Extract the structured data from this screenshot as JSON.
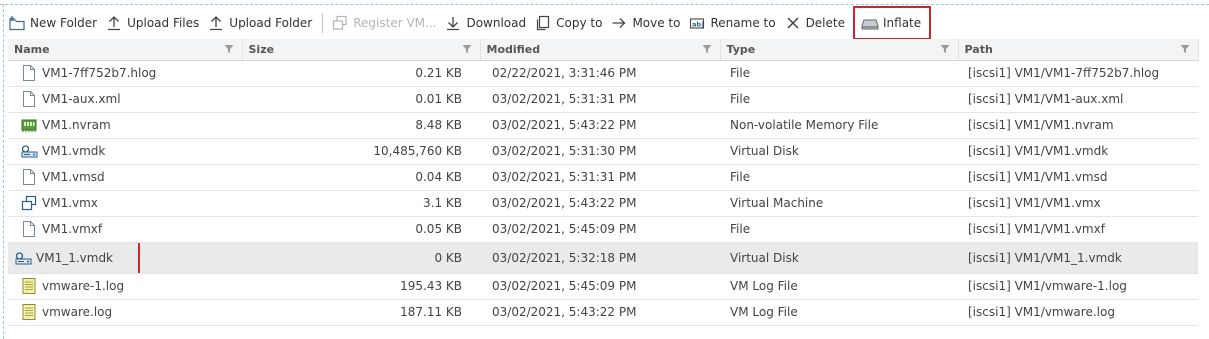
{
  "toolbar": {
    "new_folder": "New Folder",
    "upload_files": "Upload Files",
    "upload_folder": "Upload Folder",
    "register_vm": "Register VM...",
    "download": "Download",
    "copy_to": "Copy to",
    "move_to": "Move to",
    "rename_to": "Rename to",
    "delete": "Delete",
    "inflate": "Inflate"
  },
  "table": {
    "columns": [
      "Name",
      "Size",
      "Modified",
      "Type",
      "Path"
    ],
    "rows": [
      {
        "name": "VM1-7ff752b7.hlog",
        "size": "0.21 KB",
        "modified": "02/22/2021, 3:31:46 PM",
        "type": "File",
        "path": "[iscsi1] VM1/VM1-7ff752b7.hlog",
        "icon": "file-icon"
      },
      {
        "name": "VM1-aux.xml",
        "size": "0.01 KB",
        "modified": "03/02/2021, 5:31:31 PM",
        "type": "File",
        "path": "[iscsi1] VM1/VM1-aux.xml",
        "icon": "file-icon"
      },
      {
        "name": "VM1.nvram",
        "size": "8.48 KB",
        "modified": "03/02/2021, 5:43:22 PM",
        "type": "Non-volatile Memory File",
        "path": "[iscsi1] VM1/VM1.nvram",
        "icon": "nvram-icon"
      },
      {
        "name": "VM1.vmdk",
        "size": "10,485,760 KB",
        "modified": "03/02/2021, 5:31:30 PM",
        "type": "Virtual Disk",
        "path": "[iscsi1] VM1/VM1.vmdk",
        "icon": "virtual-disk-icon"
      },
      {
        "name": "VM1.vmsd",
        "size": "0.04 KB",
        "modified": "03/02/2021, 5:31:31 PM",
        "type": "File",
        "path": "[iscsi1] VM1/VM1.vmsd",
        "icon": "file-icon"
      },
      {
        "name": "VM1.vmx",
        "size": "3.1 KB",
        "modified": "03/02/2021, 5:43:22 PM",
        "type": "Virtual Machine",
        "path": "[iscsi1] VM1/VM1.vmx",
        "icon": "virtual-machine-icon"
      },
      {
        "name": "VM1.vmxf",
        "size": "0.05 KB",
        "modified": "03/02/2021, 5:45:09 PM",
        "type": "File",
        "path": "[iscsi1] VM1/VM1.vmxf",
        "icon": "file-icon"
      },
      {
        "name": "VM1_1.vmdk",
        "size": "0 KB",
        "modified": "03/02/2021, 5:32:18 PM",
        "type": "Virtual Disk",
        "path": "[iscsi1] VM1/VM1_1.vmdk",
        "icon": "virtual-disk-icon"
      },
      {
        "name": "vmware-1.log",
        "size": "195.43 KB",
        "modified": "03/02/2021, 5:45:09 PM",
        "type": "VM Log File",
        "path": "[iscsi1] VM1/vmware-1.log",
        "icon": "log-file-icon"
      },
      {
        "name": "vmware.log",
        "size": "187.11 KB",
        "modified": "03/02/2021, 5:43:22 PM",
        "type": "VM Log File",
        "path": "[iscsi1] VM1/vmware.log",
        "icon": "log-file-icon"
      }
    ]
  },
  "colors": {
    "highlight_border": "#d2232a",
    "selected_row": "#eaeaea",
    "header_bg": "#f3f4f5"
  }
}
